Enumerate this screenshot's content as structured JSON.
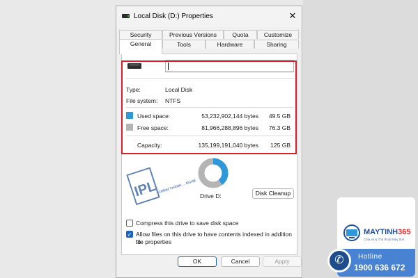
{
  "dialog": {
    "title": "Local Disk (D:) Properties",
    "close_glyph": "✕",
    "tabs_row1": [
      "Security",
      "Previous Versions",
      "Quota",
      "Customize"
    ],
    "tabs_row2": [
      "General",
      "Tools",
      "Hardware",
      "Sharing"
    ],
    "active_tab": "General"
  },
  "general": {
    "name_value": "",
    "type_label": "Type:",
    "type_value": "Local Disk",
    "fs_label": "File system:",
    "fs_value": "NTFS",
    "used": {
      "label": "Used space:",
      "bytes": "53,232,902,144 bytes",
      "size": "49.5 GB",
      "color": "#2f98d9"
    },
    "free": {
      "label": "Free space:",
      "bytes": "81,966,288,896 bytes",
      "size": "76.3 GB",
      "color": "#b4b4b4"
    },
    "capacity": {
      "label": "Capacity:",
      "bytes": "135,199,191,040 bytes",
      "size": "125 GB"
    },
    "drive_label": "Drive D:",
    "cleanup_button": "Disk Cleanup",
    "used_fraction": 0.394,
    "compress_label": "Compress this drive to save disk space",
    "compress_checked": false,
    "index_label_line1": "Allow files on this drive to have contents indexed in addition to",
    "index_label_line2": "file properties",
    "index_checked": true
  },
  "footer": {
    "ok": "OK",
    "cancel": "Cancel",
    "apply": "Apply"
  },
  "watermark": {
    "text": "IPL",
    "subtext": "CHÍNH THÀNH ... NGHIÊM TÚC"
  },
  "ad": {
    "brand_main": "MAYTINH",
    "brand_num": "365",
    "tagline": "Chia sẻ & Thủ thuật Máy tính",
    "hotline_label": "Hotline",
    "hotline_number": "1900 636 672",
    "phone_icon": "phone-icon"
  },
  "colors": {
    "highlight": "#d6232a",
    "accent": "#1e62c4"
  }
}
